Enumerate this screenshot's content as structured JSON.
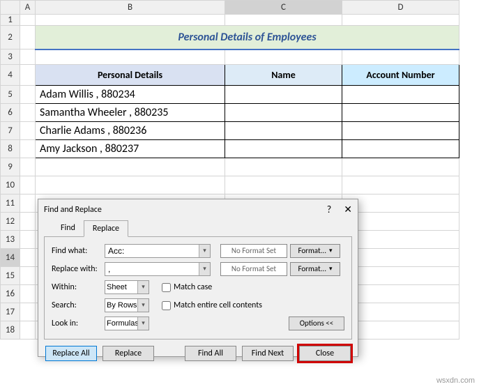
{
  "columns": [
    "A",
    "B",
    "C",
    "D"
  ],
  "rows": [
    "1",
    "2",
    "3",
    "4",
    "5",
    "6",
    "7",
    "8",
    "9",
    "10",
    "11",
    "12",
    "13",
    "14",
    "15",
    "16",
    "17",
    "18"
  ],
  "selected_col": "C",
  "selected_row": "14",
  "title": "Personal Details of Employees",
  "headers": {
    "b": "Personal Details",
    "c": "Name",
    "d": "Account Number"
  },
  "data_rows": [
    {
      "b": "Adam Willis , 880234",
      "c": "",
      "d": ""
    },
    {
      "b": "Samantha Wheeler , 880235",
      "c": "",
      "d": ""
    },
    {
      "b": "Charlie Adams , 880236",
      "c": "",
      "d": ""
    },
    {
      "b": "Amy Jackson , 880237",
      "c": "",
      "d": ""
    }
  ],
  "dialog": {
    "title": "Find and Replace",
    "help": "?",
    "close_x": "✕",
    "tabs": {
      "find": "Find",
      "replace": "Replace"
    },
    "labels": {
      "find_what": "Find what:",
      "replace_with": "Replace with:",
      "within": "Within:",
      "search": "Search:",
      "look_in": "Look in:"
    },
    "values": {
      "find_what": "Acc:",
      "replace_with": ",",
      "within": "Sheet",
      "search": "By Rows",
      "look_in": "Formulas"
    },
    "noformat": "No Format Set",
    "format_btn": "Format...",
    "checks": {
      "match_case": "Match case",
      "match_entire": "Match entire cell contents"
    },
    "options_btn": "Options <<",
    "buttons": {
      "replace_all": "Replace All",
      "replace": "Replace",
      "find_all": "Find All",
      "find_next": "Find Next",
      "close": "Close"
    }
  },
  "watermark": "wsxdn.com",
  "chart_data": {
    "type": "table",
    "title": "Personal Details of Employees",
    "columns": [
      "Personal Details",
      "Name",
      "Account Number"
    ],
    "rows": [
      [
        "Adam Willis , 880234",
        "",
        ""
      ],
      [
        "Samantha Wheeler , 880235",
        "",
        ""
      ],
      [
        "Charlie Adams , 880236",
        "",
        ""
      ],
      [
        "Amy Jackson , 880237",
        "",
        ""
      ]
    ]
  }
}
